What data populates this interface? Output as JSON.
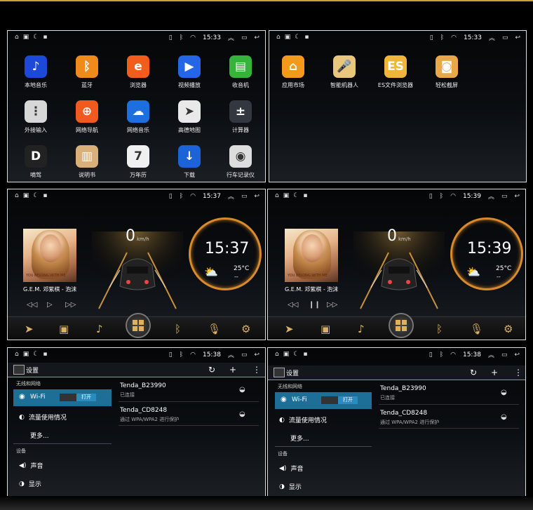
{
  "status": {
    "p1_time": "15:33",
    "p2_time": "15:33",
    "p3_time": "15:37",
    "p4_time": "15:39",
    "p5_time": "15:38",
    "p6_time": "15:38"
  },
  "home1": {
    "apps": [
      {
        "label": "本地音乐",
        "color": "#1c49d8",
        "glyph": "♪"
      },
      {
        "label": "蓝牙",
        "color": "#f08a1a",
        "glyph": "ᛒ"
      },
      {
        "label": "浏览器",
        "color": "#f25d1c",
        "glyph": "e"
      },
      {
        "label": "视频播放",
        "color": "#2467e6",
        "glyph": "▶"
      },
      {
        "label": "收音机",
        "color": "#34b53a",
        "glyph": "▤"
      },
      {
        "label": "外接输入",
        "color": "#d7d7d7",
        "glyph": "⋮"
      },
      {
        "label": "网络导航",
        "color": "#f05a1e",
        "glyph": "⊕"
      },
      {
        "label": "网络音乐",
        "color": "#1d6fe0",
        "glyph": "☁"
      },
      {
        "label": "高德地图",
        "color": "#e9e9e9",
        "glyph": "➤"
      },
      {
        "label": "计算器",
        "color": "#333840",
        "glyph": "±"
      },
      {
        "label": "嘀驾",
        "color": "#222222",
        "glyph": "D"
      },
      {
        "label": "说明书",
        "color": "#d9b07a",
        "glyph": "▥"
      },
      {
        "label": "万年历",
        "color": "#f0f0f0",
        "glyph": "7"
      },
      {
        "label": "下载",
        "color": "#1b63d6",
        "glyph": "↓"
      },
      {
        "label": "行车记录仪",
        "color": "#dddddd",
        "glyph": "◉"
      }
    ]
  },
  "home2": {
    "apps": [
      {
        "label": "应用市场",
        "color": "#f39a1c",
        "glyph": "⌂"
      },
      {
        "label": "智能机器人",
        "color": "#e8c77c",
        "glyph": "🎤"
      },
      {
        "label": "ES文件浏览器",
        "color": "#f0b63a",
        "glyph": "ES"
      },
      {
        "label": "轻松截屏",
        "color": "#e8a848",
        "glyph": "◙"
      }
    ]
  },
  "dash": {
    "track": "G.E.M. 邓紫棋 - 泡沫",
    "album_text": "YOU BELONG WITH ME",
    "speed": "0",
    "speed_unit": "km/h",
    "clock1": "15:37",
    "clock2": "15:39",
    "temp": "25°C",
    "weather_extra": "--"
  },
  "settings": {
    "title": "设置",
    "cat_wireless": "无线和网络",
    "wifi": "Wi-Fi",
    "switch_on": "打开",
    "data_usage": "流量使用情况",
    "more": "更多...",
    "cat_device": "设备",
    "sound": "声音",
    "display": "显示",
    "net1_name": "Tenda_B23990",
    "net1_status": "已连接",
    "net2_name": "Tenda_CD8248",
    "net2_status": "通过 WPA/WPA2 进行保护"
  }
}
